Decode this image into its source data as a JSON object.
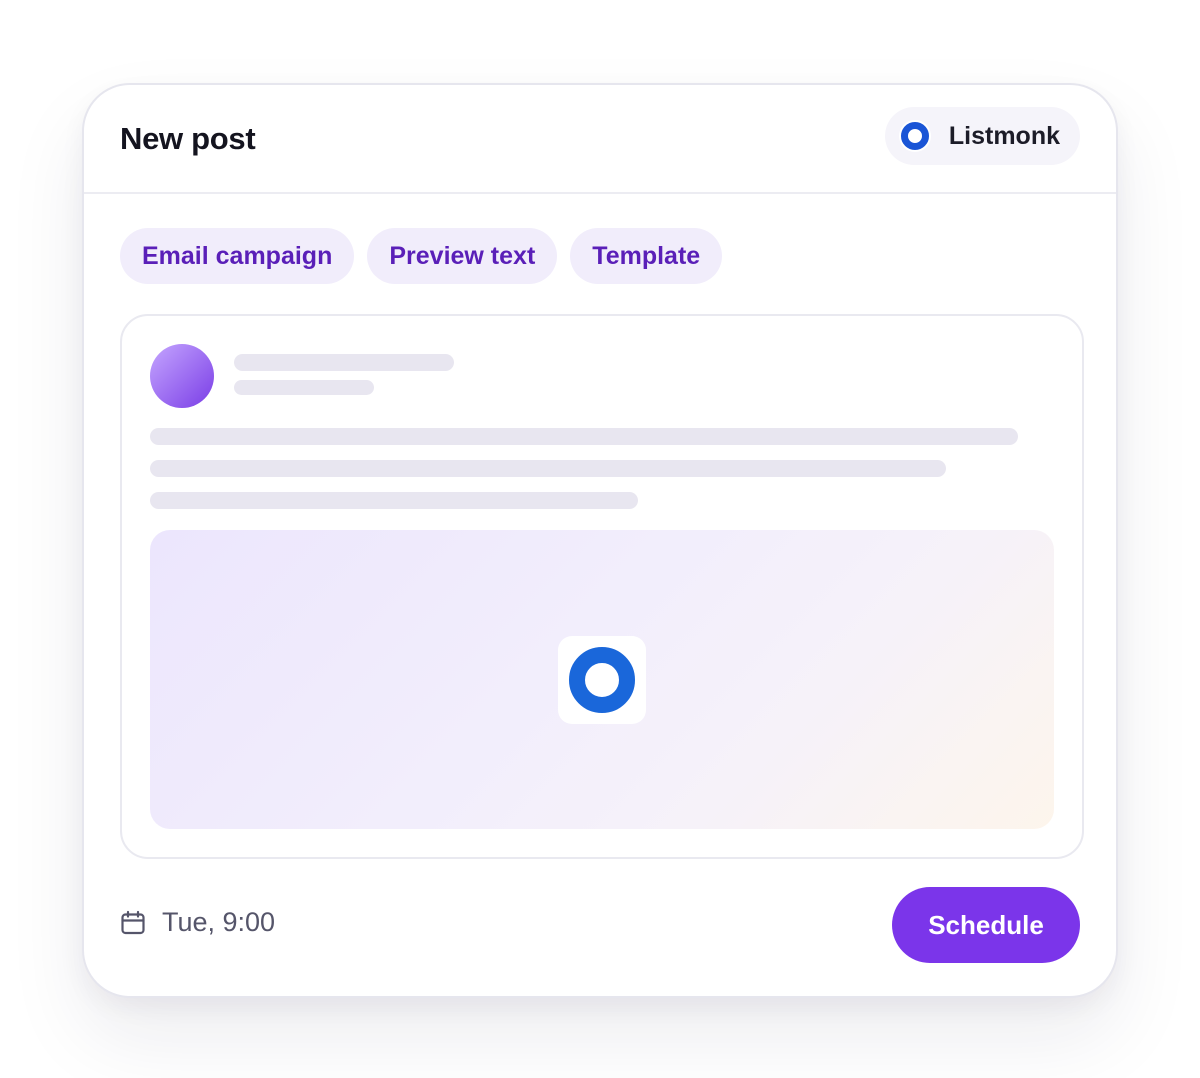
{
  "header": {
    "title": "New post",
    "channel": {
      "label": "Listmonk",
      "icon": "listmonk-ring-icon",
      "icon_color": "#1a55d6"
    }
  },
  "tabs": [
    {
      "label": "Email campaign"
    },
    {
      "label": "Preview text"
    },
    {
      "label": "Template"
    }
  ],
  "preview": {
    "avatar": "avatar-placeholder",
    "media_icon": "listmonk-ring-icon"
  },
  "footer": {
    "date_icon": "calendar-icon",
    "date_label": "Tue, 9:00",
    "schedule_label": "Schedule"
  },
  "colors": {
    "accent": "#7b35ea",
    "tab_text": "#5a1fb8",
    "tab_bg": "#f1edfb",
    "skeleton": "#e8e6f0"
  }
}
